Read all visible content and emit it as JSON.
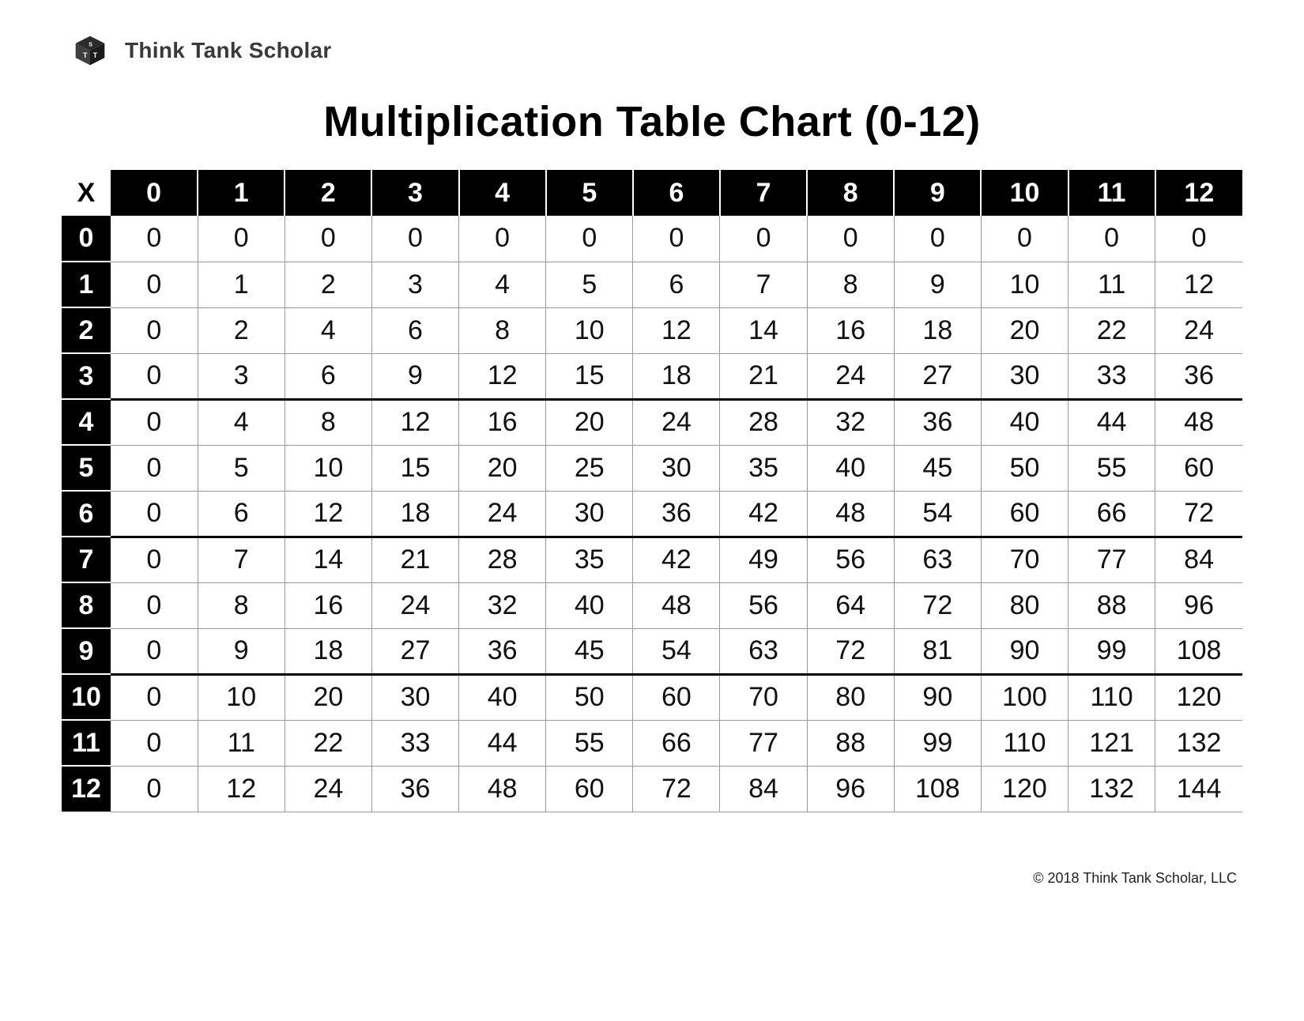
{
  "brand": "Think Tank Scholar",
  "title": "Multiplication Table Chart (0-12)",
  "corner_label": "X",
  "columns": [
    "0",
    "1",
    "2",
    "3",
    "4",
    "5",
    "6",
    "7",
    "8",
    "9",
    "10",
    "11",
    "12"
  ],
  "rows": [
    {
      "label": "0",
      "cells": [
        "0",
        "0",
        "0",
        "0",
        "0",
        "0",
        "0",
        "0",
        "0",
        "0",
        "0",
        "0",
        "0"
      ]
    },
    {
      "label": "1",
      "cells": [
        "0",
        "1",
        "2",
        "3",
        "4",
        "5",
        "6",
        "7",
        "8",
        "9",
        "10",
        "11",
        "12"
      ]
    },
    {
      "label": "2",
      "cells": [
        "0",
        "2",
        "4",
        "6",
        "8",
        "10",
        "12",
        "14",
        "16",
        "18",
        "20",
        "22",
        "24"
      ]
    },
    {
      "label": "3",
      "cells": [
        "0",
        "3",
        "6",
        "9",
        "12",
        "15",
        "18",
        "21",
        "24",
        "27",
        "30",
        "33",
        "36"
      ]
    },
    {
      "label": "4",
      "cells": [
        "0",
        "4",
        "8",
        "12",
        "16",
        "20",
        "24",
        "28",
        "32",
        "36",
        "40",
        "44",
        "48"
      ]
    },
    {
      "label": "5",
      "cells": [
        "0",
        "5",
        "10",
        "15",
        "20",
        "25",
        "30",
        "35",
        "40",
        "45",
        "50",
        "55",
        "60"
      ]
    },
    {
      "label": "6",
      "cells": [
        "0",
        "6",
        "12",
        "18",
        "24",
        "30",
        "36",
        "42",
        "48",
        "54",
        "60",
        "66",
        "72"
      ]
    },
    {
      "label": "7",
      "cells": [
        "0",
        "7",
        "14",
        "21",
        "28",
        "35",
        "42",
        "49",
        "56",
        "63",
        "70",
        "77",
        "84"
      ]
    },
    {
      "label": "8",
      "cells": [
        "0",
        "8",
        "16",
        "24",
        "32",
        "40",
        "48",
        "56",
        "64",
        "72",
        "80",
        "88",
        "96"
      ]
    },
    {
      "label": "9",
      "cells": [
        "0",
        "9",
        "18",
        "27",
        "36",
        "45",
        "54",
        "63",
        "72",
        "81",
        "90",
        "99",
        "108"
      ]
    },
    {
      "label": "10",
      "cells": [
        "0",
        "10",
        "20",
        "30",
        "40",
        "50",
        "60",
        "70",
        "80",
        "90",
        "100",
        "110",
        "120"
      ]
    },
    {
      "label": "11",
      "cells": [
        "0",
        "11",
        "22",
        "33",
        "44",
        "55",
        "66",
        "77",
        "88",
        "99",
        "110",
        "121",
        "132"
      ]
    },
    {
      "label": "12",
      "cells": [
        "0",
        "12",
        "24",
        "36",
        "48",
        "60",
        "72",
        "84",
        "96",
        "108",
        "120",
        "132",
        "144"
      ]
    }
  ],
  "section_starts": [
    0,
    4,
    7,
    10
  ],
  "copyright": "© 2018 Think Tank Scholar, LLC",
  "chart_data": {
    "type": "table",
    "title": "Multiplication Table Chart (0-12)",
    "columns": [
      0,
      1,
      2,
      3,
      4,
      5,
      6,
      7,
      8,
      9,
      10,
      11,
      12
    ],
    "rows": [
      0,
      1,
      2,
      3,
      4,
      5,
      6,
      7,
      8,
      9,
      10,
      11,
      12
    ],
    "values": [
      [
        0,
        0,
        0,
        0,
        0,
        0,
        0,
        0,
        0,
        0,
        0,
        0,
        0
      ],
      [
        0,
        1,
        2,
        3,
        4,
        5,
        6,
        7,
        8,
        9,
        10,
        11,
        12
      ],
      [
        0,
        2,
        4,
        6,
        8,
        10,
        12,
        14,
        16,
        18,
        20,
        22,
        24
      ],
      [
        0,
        3,
        6,
        9,
        12,
        15,
        18,
        21,
        24,
        27,
        30,
        33,
        36
      ],
      [
        0,
        4,
        8,
        12,
        16,
        20,
        24,
        28,
        32,
        36,
        40,
        44,
        48
      ],
      [
        0,
        5,
        10,
        15,
        20,
        25,
        30,
        35,
        40,
        45,
        50,
        55,
        60
      ],
      [
        0,
        6,
        12,
        18,
        24,
        30,
        36,
        42,
        48,
        54,
        60,
        66,
        72
      ],
      [
        0,
        7,
        14,
        21,
        28,
        35,
        42,
        49,
        56,
        63,
        70,
        77,
        84
      ],
      [
        0,
        8,
        16,
        24,
        32,
        40,
        48,
        56,
        64,
        72,
        80,
        88,
        96
      ],
      [
        0,
        9,
        18,
        27,
        36,
        45,
        54,
        63,
        72,
        81,
        90,
        99,
        108
      ],
      [
        0,
        10,
        20,
        30,
        40,
        50,
        60,
        70,
        80,
        90,
        100,
        110,
        120
      ],
      [
        0,
        11,
        22,
        33,
        44,
        55,
        66,
        77,
        88,
        99,
        110,
        121,
        132
      ],
      [
        0,
        12,
        24,
        36,
        48,
        60,
        72,
        84,
        96,
        108,
        120,
        132,
        144
      ]
    ]
  }
}
